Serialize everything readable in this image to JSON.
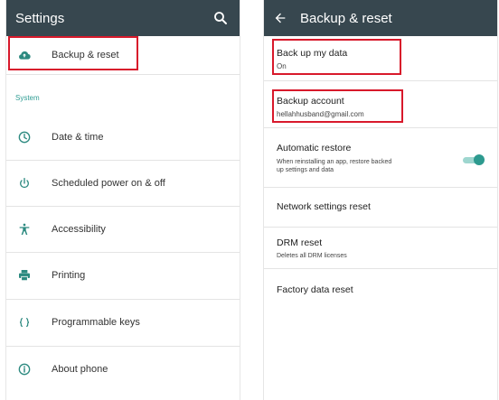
{
  "left": {
    "title": "Settings",
    "top_item": {
      "label": "Backup & reset",
      "icon": "cloud-upload-icon"
    },
    "section_label": "System",
    "items": [
      {
        "label": "Date & time",
        "icon": "clock-icon"
      },
      {
        "label": "Scheduled power on & off",
        "icon": "power-icon"
      },
      {
        "label": "Accessibility",
        "icon": "accessibility-icon"
      },
      {
        "label": "Printing",
        "icon": "printer-icon"
      },
      {
        "label": "Programmable keys",
        "icon": "code-brackets-icon"
      },
      {
        "label": "About phone",
        "icon": "info-icon"
      }
    ]
  },
  "right": {
    "title": "Backup & reset",
    "items": [
      {
        "title": "Back up my data",
        "subtitle": "On"
      },
      {
        "title": "Backup account",
        "subtitle": "hellahhusband@gmail.com"
      },
      {
        "title": "Automatic restore",
        "subtitle_1": "When reinstalling an app, restore backed",
        "subtitle_2": "up settings and data",
        "toggle_on": true
      },
      {
        "title": "Network settings reset"
      },
      {
        "title": "DRM reset",
        "subtitle": "Deletes all DRM licenses"
      },
      {
        "title": "Factory data reset"
      }
    ]
  },
  "colors": {
    "appbar": "#37474f",
    "accent": "#2f9d94",
    "highlight": "#d8192b",
    "icon": "#2d8a80"
  }
}
